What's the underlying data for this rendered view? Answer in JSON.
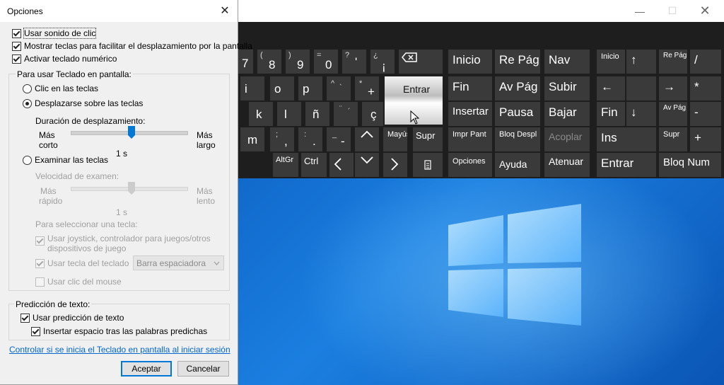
{
  "dialog": {
    "title": "Opciones",
    "top_checks": [
      {
        "label": "Usar sonido de clic",
        "checked": true
      },
      {
        "label": "Mostrar teclas para facilitar el desplazamiento por la pantalla",
        "checked": true
      },
      {
        "label": "Activar teclado numérico",
        "checked": true
      }
    ],
    "group_osk": {
      "label": "Para usar Teclado en pantalla:",
      "radio_click": "Clic en las teclas",
      "radio_hover": "Desplazarse sobre las teclas",
      "hover_duration_label": "Duración de desplazamiento:",
      "hover_more": "Más",
      "hover_short": "corto",
      "hover_more2": "Más",
      "hover_long": "largo",
      "hover_value": "1 s",
      "radio_scan": "Examinar las teclas",
      "scan_speed_label": "Velocidad de examen:",
      "scan_more": "Más",
      "scan_fast": "rápido",
      "scan_more2": "Más",
      "scan_slow": "lento",
      "scan_value": "1 s",
      "select_key_label": "Para seleccionar una tecla:",
      "joystick_line1": "Usar joystick, controlador para juegos/otros",
      "joystick_line2": "dispositivos de juego",
      "keyboard_key_label": "Usar tecla del teclado",
      "keyboard_key_value": "Barra espaciadora",
      "mouse_click_label": "Usar clic del mouse",
      "selected_radio": "hover",
      "hover_slider_fraction": 0.5,
      "scan_slider_fraction": 0.5
    },
    "group_prediction": {
      "label": "Predicción de texto:",
      "use_prediction": "Usar predicción de texto",
      "insert_space": "Insertar espacio tras las palabras predichas"
    },
    "link": "Controlar si se inicia el Teclado en pantalla al iniciar sesión",
    "accept_button": "Aceptar",
    "cancel_button": "Cancelar"
  },
  "osk": {
    "titlebar_buttons": [
      "minimize-icon",
      "maximize-icon",
      "close-icon"
    ],
    "keys": {
      "k7": "7",
      "k8": "8",
      "k8_top": "(",
      "k9": "9",
      "k9_top": ")",
      "k0": "0",
      "k0_top": "=",
      "kq": "?",
      "kq2": "'",
      "kexcl": "¿",
      "kexcl2": "¡",
      "ki": "i",
      "ko": "o",
      "kp": "p",
      "kcaret": "^",
      "kcaret2": "`",
      "kstar": "*",
      "kplus": "+",
      "kentrar": "Entrar",
      "kk": "k",
      "kl": "l",
      "kn": "ñ",
      "kdiaer": "¨",
      "kacute": "´",
      "kc": "ç",
      "km": "m",
      "ksemi": ";",
      "kcomma": ",",
      "kcolon": ":",
      "kdot": ".",
      "kunder": "_",
      "kminus": "-",
      "kmayus": "Mayús",
      "ksupr_main": "Supr",
      "kaltgr": "AltGr",
      "kctrl": "Ctrl",
      "kinicio": "Inicio",
      "krepag": "Re Pág",
      "knav": "Nav",
      "kfin": "Fin",
      "kavpag": "Av Pág",
      "ksubir": "Subir",
      "kinsertar": "Insertar",
      "kpausa": "Pausa",
      "kbajar": "Bajar",
      "kimpr": "Impr Pant",
      "kbloqdespl": "Bloq Despl",
      "kacoplar": "Acoplar",
      "kopciones": "Opciones",
      "kayuda": "Ayuda",
      "katenuar": "Atenuar",
      "np_inicio": "Inicio",
      "np_up": "↑",
      "np_repag": "Re Pág",
      "np_slash": "/",
      "np_left": "←",
      "np_right": "→",
      "np_star": "*",
      "np_fin": "Fin",
      "np_down": "↓",
      "np_avpag": "Av Pág",
      "np_minus": "-",
      "np_ins": "Ins",
      "np_supr": "Supr",
      "np_plus": "+",
      "np_entrar": "Entrar",
      "np_bloqnum": "Bloq Num"
    }
  },
  "colors": {
    "accent": "#0078d7",
    "osk_bg": "#1e1e1e",
    "key_bg": "#3a3a3a",
    "link": "#0066cc"
  }
}
